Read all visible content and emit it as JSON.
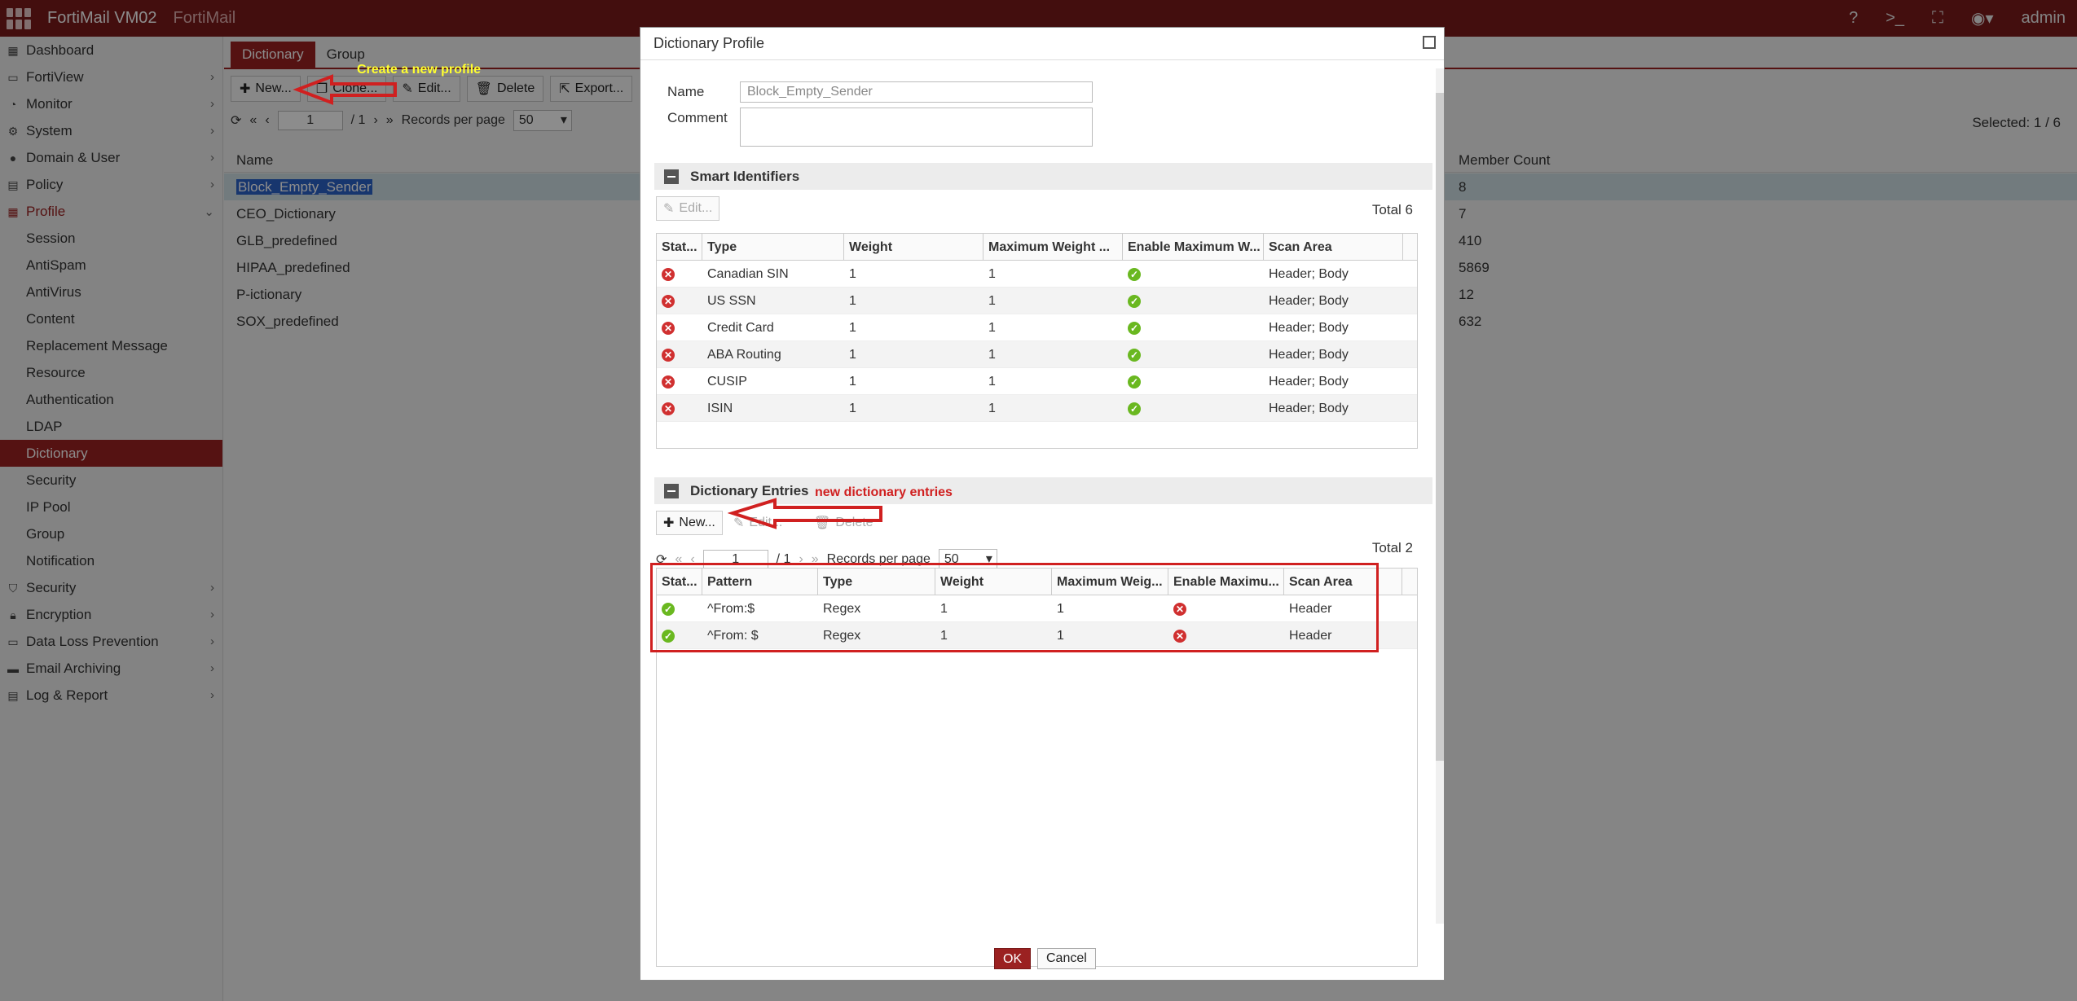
{
  "topbar": {
    "product": "FortiMail VM02",
    "hostname": "FortiMail",
    "user": "admin"
  },
  "sidebar": {
    "items": [
      {
        "label": "Dashboard"
      },
      {
        "label": "FortiView"
      },
      {
        "label": "Monitor"
      },
      {
        "label": "System"
      },
      {
        "label": "Domain & User"
      },
      {
        "label": "Policy"
      },
      {
        "label": "Profile"
      },
      {
        "label": "Session"
      },
      {
        "label": "AntiSpam"
      },
      {
        "label": "AntiVirus"
      },
      {
        "label": "Content"
      },
      {
        "label": "Replacement Message"
      },
      {
        "label": "Resource"
      },
      {
        "label": "Authentication"
      },
      {
        "label": "LDAP"
      },
      {
        "label": "Dictionary"
      },
      {
        "label": "Security"
      },
      {
        "label": "IP Pool"
      },
      {
        "label": "Group"
      },
      {
        "label": "Notification"
      },
      {
        "label": "Security"
      },
      {
        "label": "Encryption"
      },
      {
        "label": "Data Loss Prevention"
      },
      {
        "label": "Email Archiving"
      },
      {
        "label": "Log & Report"
      }
    ]
  },
  "main": {
    "tabs": [
      "Dictionary",
      "Group"
    ],
    "toolbar": {
      "new": "New...",
      "clone": "Clone...",
      "edit": "Edit...",
      "delete": "Delete",
      "export": "Export..."
    },
    "pager": {
      "page": "1",
      "of": "/ 1",
      "records_label": "Records per page",
      "records_value": "50"
    },
    "selected": "Selected: 1 / 6",
    "columns": {
      "name": "Name",
      "member_count": "Member Count"
    },
    "rows": [
      {
        "name": "Block_Empty_Sender",
        "count": "8"
      },
      {
        "name": "CEO_Dictionary",
        "count": "7"
      },
      {
        "name": "GLB_predefined",
        "count": "410"
      },
      {
        "name": "HIPAA_predefined",
        "count": "5869"
      },
      {
        "name": "P-ictionary",
        "count": "12"
      },
      {
        "name": "SOX_predefined",
        "count": "632"
      }
    ]
  },
  "annotations": {
    "create": "Create a new profile",
    "entries": "new dictionary entries"
  },
  "dialog": {
    "title": "Dictionary Profile",
    "name_label": "Name",
    "name_value": "Block_Empty_Sender",
    "comment_label": "Comment",
    "smart": {
      "title": "Smart Identifiers",
      "edit": "Edit...",
      "total": "Total 6",
      "columns": [
        "Stat...",
        "Type",
        "Weight",
        "Maximum Weight ...",
        "Enable Maximum W...",
        "Scan Area"
      ],
      "rows": [
        {
          "type": "Canadian SIN",
          "weight": "1",
          "max": "1",
          "scan": "Header; Body"
        },
        {
          "type": "US SSN",
          "weight": "1",
          "max": "1",
          "scan": "Header; Body"
        },
        {
          "type": "Credit Card",
          "weight": "1",
          "max": "1",
          "scan": "Header; Body"
        },
        {
          "type": "ABA Routing",
          "weight": "1",
          "max": "1",
          "scan": "Header; Body"
        },
        {
          "type": "CUSIP",
          "weight": "1",
          "max": "1",
          "scan": "Header; Body"
        },
        {
          "type": "ISIN",
          "weight": "1",
          "max": "1",
          "scan": "Header; Body"
        }
      ]
    },
    "entries": {
      "title": "Dictionary Entries",
      "new": "New...",
      "edit": "Edit...",
      "delete": "Delete",
      "page": "1",
      "of": "/ 1",
      "records_label": "Records per page",
      "records_value": "50",
      "total": "Total 2",
      "columns": [
        "Stat...",
        "Pattern",
        "Type",
        "Weight",
        "Maximum Weig...",
        "Enable Maximu...",
        "Scan Area"
      ],
      "rows": [
        {
          "pattern": "^From:$",
          "type": "Regex",
          "weight": "1",
          "max": "1",
          "scan": "Header"
        },
        {
          "pattern": "^From: $",
          "type": "Regex",
          "weight": "1",
          "max": "1",
          "scan": "Header"
        }
      ]
    },
    "ok": "OK",
    "cancel": "Cancel"
  },
  "colors": {
    "brand": "#7a1b1b",
    "accent": "#9b2121",
    "ok": "#6ab820",
    "error": "#d03030"
  }
}
